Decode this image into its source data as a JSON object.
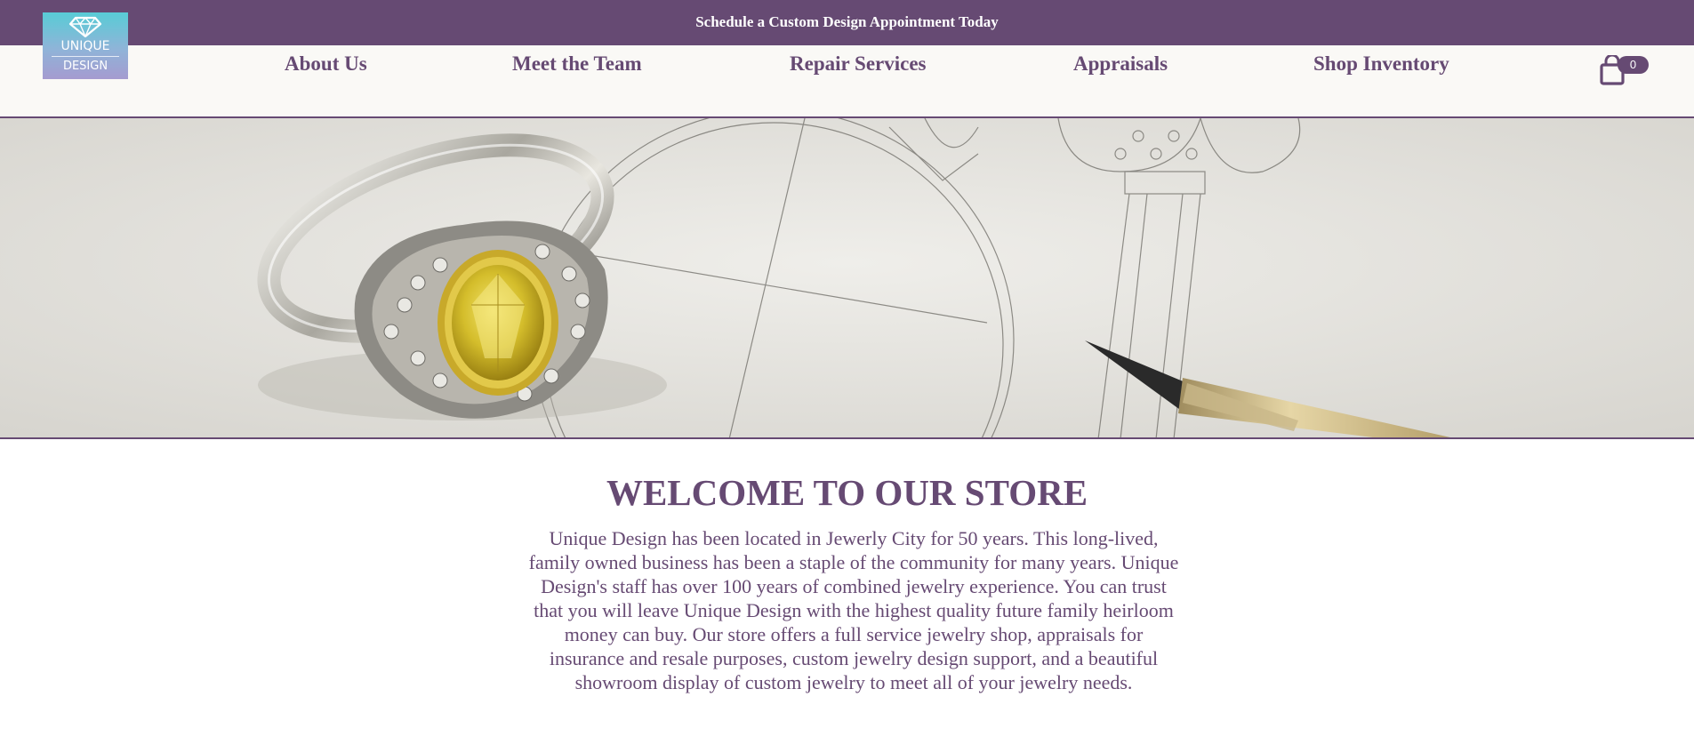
{
  "announcement": {
    "text": "Schedule a Custom Design Appointment Today"
  },
  "logo": {
    "line1": "UNIQUE",
    "line2": "DESIGN",
    "icon": "diamond-icon"
  },
  "nav": {
    "items": [
      {
        "label": "About Us"
      },
      {
        "label": "Meet the Team"
      },
      {
        "label": "Repair Services"
      },
      {
        "label": "Appraisals"
      },
      {
        "label": "Shop Inventory"
      }
    ]
  },
  "cart": {
    "icon": "shopping-bag-icon",
    "count": "0"
  },
  "hero": {
    "image": "ring-and-sketch-photo"
  },
  "welcome": {
    "title": "WELCOME TO OUR STORE",
    "body": "Unique Design has been located in Jewerly City for 50 years. This long-lived, family owned business has been a staple of the community for many years. Unique Design's staff has over 100 years of combined jewelry experience. You can trust that you will leave Unique Design with the highest quality future family heirloom money can buy. Our store offers a full service jewelry shop, appraisals for insurance and resale purposes, custom jewelry design support, and a beautiful showroom display of custom jewelry to meet all of your jewelry needs."
  },
  "colors": {
    "brand": "#664a73",
    "header_bg": "#faf9f6",
    "text_on_brand": "#ffffff",
    "logo_top": "#58ccd6",
    "logo_bottom": "#a59bd0"
  }
}
